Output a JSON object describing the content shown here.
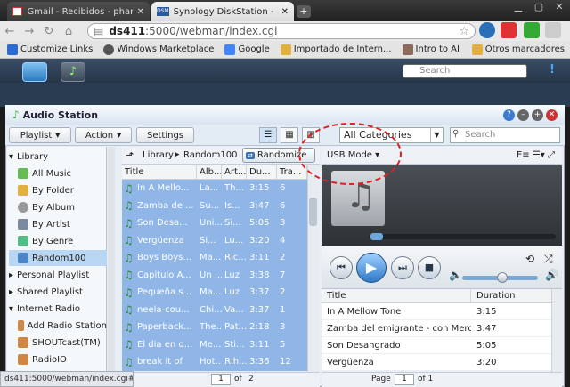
{
  "browser": {
    "tabs": [
      {
        "label": "Gmail - Recibidos - pharizn",
        "icon": "gmail-icon"
      },
      {
        "label": "Synology DiskStation - DS4",
        "icon": "dsm-icon"
      }
    ],
    "url_host": "ds411",
    "url_rest": ":5000/webman/index.cgi",
    "bookmarks": [
      "Customize Links",
      "Windows Marketplace",
      "Google",
      "Importado de Intern...",
      "Intro to AI"
    ],
    "other_bookmarks": "Otros marcadores",
    "status_url": "ds411:5000/webman/index.cgi#"
  },
  "dsm": {
    "search_placeholder": "Search"
  },
  "app": {
    "title": "Audio Station",
    "buttons": {
      "playlist": "Playlist",
      "action": "Action",
      "settings": "Settings",
      "randomize": "Randomize"
    },
    "category": "All Categories",
    "search_placeholder": "Search",
    "usb_mode": "USB Mode",
    "breadcrumb": {
      "root": "Library",
      "current": "Random100"
    },
    "page_label": "of",
    "page_value": "1",
    "page_total": "2"
  },
  "sidebar": {
    "library": "Library",
    "items": [
      {
        "label": "All Music"
      },
      {
        "label": "By Folder"
      },
      {
        "label": "By Album"
      },
      {
        "label": "By Artist"
      },
      {
        "label": "By Genre"
      },
      {
        "label": "Random100"
      }
    ],
    "personal": "Personal Playlist",
    "shared": "Shared Playlist",
    "radio": "Internet Radio",
    "radio_items": [
      {
        "label": "Add Radio Station"
      },
      {
        "label": "SHOUTcast(TM)"
      },
      {
        "label": "RadioIO"
      }
    ]
  },
  "table": {
    "headers": [
      "Title",
      "Alb...",
      "Art...",
      "Du...",
      "Tra..."
    ],
    "rows": [
      [
        "In A Mello...",
        "La...",
        "Th...",
        "3:15",
        "6"
      ],
      [
        "Zamba de ...",
        "Su...",
        "Is...",
        "3:47",
        "6"
      ],
      [
        "Son Desa...",
        "Uni...",
        "Si...",
        "5:05",
        "3"
      ],
      [
        "Vergüenza",
        "Si...",
        "Lu...",
        "3:20",
        "4"
      ],
      [
        "Boys Boys...",
        "Ma...",
        "Ric...",
        "3:11",
        "2"
      ],
      [
        "Capitulo A...",
        "Un ...",
        "Luz",
        "3:38",
        "7"
      ],
      [
        "Pequeña s...",
        "Ma...",
        "Luz",
        "3:37",
        "2"
      ],
      [
        "neela-cou...",
        "Chi...",
        "Va...",
        "3:37",
        "1"
      ],
      [
        "Paperback...",
        "The...",
        "Pat...",
        "2:18",
        "3"
      ],
      [
        "El dia en q...",
        "Me...",
        "Sti...",
        "3:11",
        "5"
      ],
      [
        "break it of",
        "Hot...",
        "Rih...",
        "3:36",
        "12"
      ]
    ]
  },
  "playlist": {
    "headers": {
      "title": "Title",
      "duration": "Duration"
    },
    "rows": [
      {
        "title": "In A Mellow Tone",
        "duration": "3:15"
      },
      {
        "title": "Zamba del emigrante - con Merce...",
        "duration": "3:47"
      },
      {
        "title": "Son Desangrado",
        "duration": "5:05"
      },
      {
        "title": "Vergüenza",
        "duration": "3:20"
      }
    ],
    "page_label": "Page",
    "page_value": "1",
    "page_of": "of 1"
  }
}
